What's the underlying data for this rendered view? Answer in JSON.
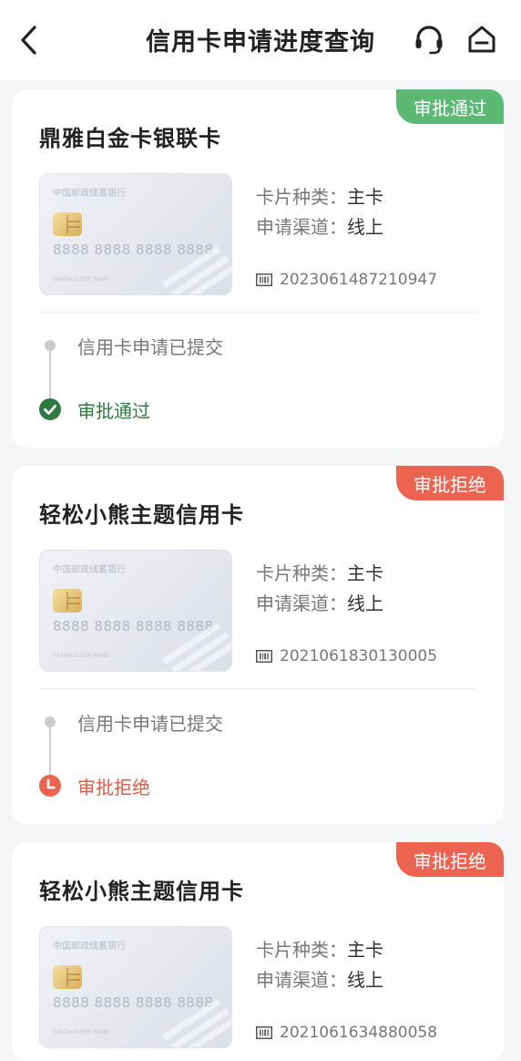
{
  "header": {
    "title": "信用卡申请进度查询",
    "back_icon": "chevron-left-icon",
    "service_icon": "headset-icon",
    "home_icon": "home-icon"
  },
  "card_face": {
    "bank_name": "中国邮政储蓄银行",
    "number": "8888 8888 8888 8888",
    "holder": "CARDHOLDER NAME"
  },
  "labels": {
    "card_type": "卡片种类：",
    "channel": "申请渠道：",
    "barcode_icon": "barcode-icon"
  },
  "colors": {
    "approved": "#5bb974",
    "rejected": "#ec6350",
    "approved_text": "#2f7a42"
  },
  "applications": [
    {
      "name": "鼎雅白金卡银联卡",
      "status": "审批通过",
      "card_type": "主卡",
      "channel": "线上",
      "application_no": "2023061487210947",
      "steps": [
        "信用卡申请已提交",
        "审批通过"
      ]
    },
    {
      "name": "轻松小熊主题信用卡",
      "status": "审批拒绝",
      "card_type": "主卡",
      "channel": "线上",
      "application_no": "2021061830130005",
      "steps": [
        "信用卡申请已提交",
        "审批拒绝"
      ]
    },
    {
      "name": "轻松小熊主题信用卡",
      "status": "审批拒绝",
      "card_type": "主卡",
      "channel": "线上",
      "application_no": "2021061634880058",
      "steps": []
    }
  ]
}
